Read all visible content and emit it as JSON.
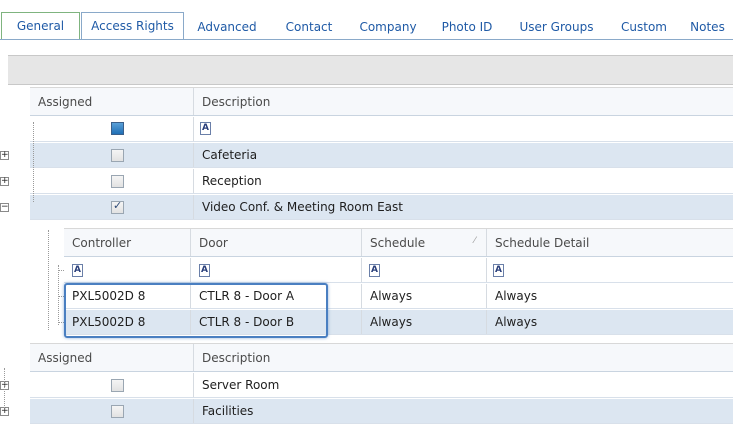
{
  "tabs": [
    {
      "label": "General"
    },
    {
      "label": "Access Rights"
    },
    {
      "label": "Advanced"
    },
    {
      "label": "Contact"
    },
    {
      "label": "Company"
    },
    {
      "label": "Photo ID"
    },
    {
      "label": "User Groups"
    },
    {
      "label": "Custom"
    },
    {
      "label": "Notes"
    }
  ],
  "grid": {
    "columns": {
      "assigned": "Assigned",
      "description": "Description"
    },
    "filter_glyph": "A",
    "rows_top": [
      {
        "description": "Cafeteria",
        "checked": false
      },
      {
        "description": "Reception",
        "checked": false
      },
      {
        "description": "Video Conf. & Meeting Room East",
        "checked": true
      }
    ],
    "rows_bottom": [
      {
        "description": "Server Room",
        "checked": false
      },
      {
        "description": "Facilities",
        "checked": false
      }
    ]
  },
  "detail": {
    "columns": {
      "controller": "Controller",
      "door": "Door",
      "schedule": "Schedule",
      "schedule_detail": "Schedule Detail"
    },
    "rows": [
      {
        "controller": "PXL5002D 8",
        "door": "CTLR 8 - Door A",
        "schedule": "Always",
        "schedule_detail": "Always"
      },
      {
        "controller": "PXL5002D 8",
        "door": "CTLR 8 - Door B",
        "schedule": "Always",
        "schedule_detail": "Always"
      }
    ]
  },
  "colors": {
    "accent": "#4a7fc1",
    "row_alt": "#dce6f1"
  }
}
